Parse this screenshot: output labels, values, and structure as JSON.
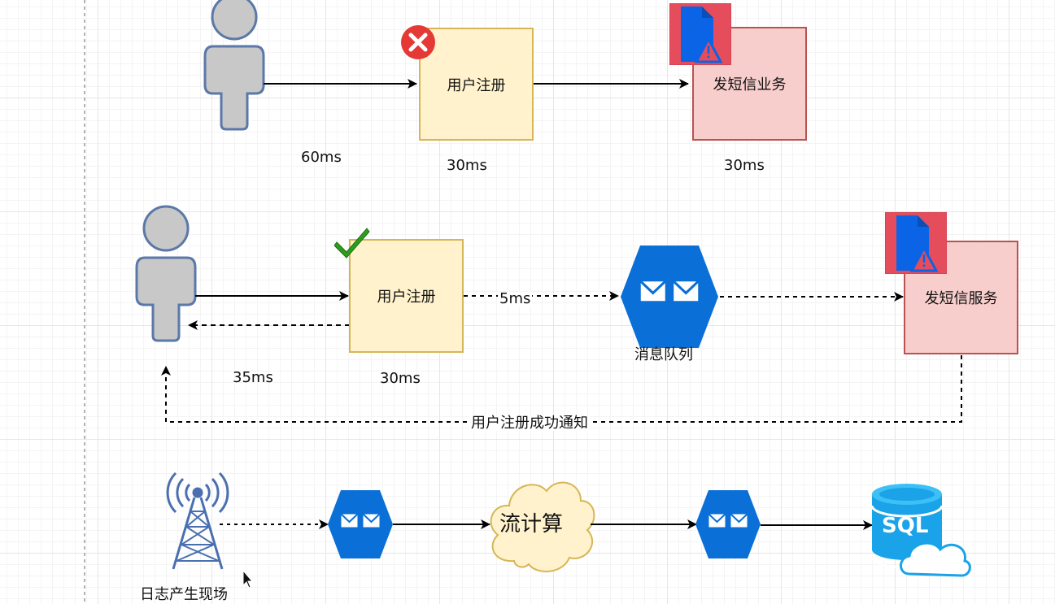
{
  "row1": {
    "register": "用户注册",
    "sms": "发短信业务",
    "t_user": "60ms",
    "t_register": "30ms",
    "t_sms": "30ms"
  },
  "row2": {
    "register": "用户注册",
    "sms": "发短信服务",
    "queue": "消息队列",
    "t_mq": "5ms",
    "t_user": "35ms",
    "t_register": "30ms",
    "notify": "用户注册成功通知"
  },
  "row3": {
    "log": "日志产生现场",
    "stream": "流计算",
    "sql": "SQL"
  },
  "colors": {
    "user_fill": "#c8c8c8",
    "user_stroke": "#5a78a8",
    "queue_blue": "#0a6fd6",
    "error_red": "#e53935",
    "check_green": "#2e9d1e",
    "doc_blue": "#0b63e6",
    "doc_bg": "#e64d5c"
  },
  "icons": [
    "user-icon",
    "error-icon",
    "check-icon",
    "doc-warning-icon",
    "message-queue-icon",
    "cloud-shape",
    "antenna-icon",
    "sql-database-icon",
    "cursor-icon"
  ]
}
